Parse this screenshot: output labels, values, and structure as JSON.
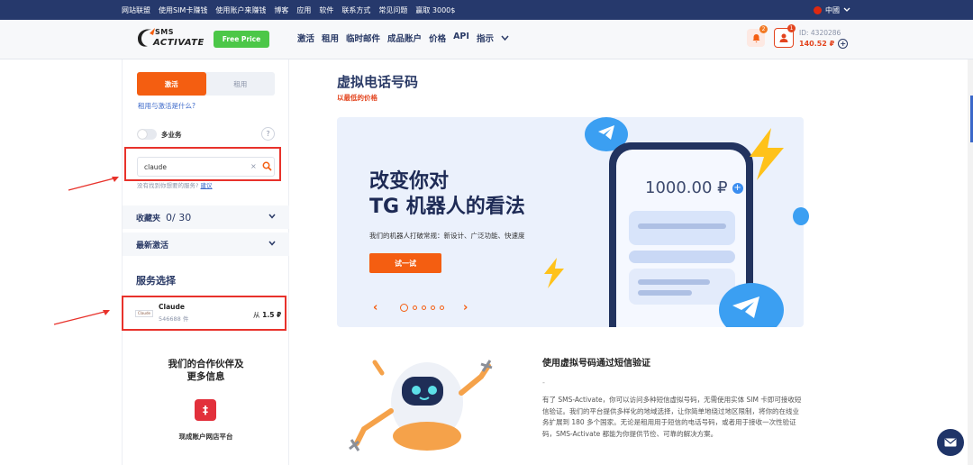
{
  "topbar": {
    "links": [
      "网站联盟",
      "使用SIM卡赚钱",
      "使用账户来赚钱",
      "博客",
      "应用",
      "软件",
      "联系方式",
      "常见问题",
      "赢取 3000$"
    ],
    "language": "中國"
  },
  "header": {
    "logo_line1": "SMS",
    "logo_line2": "ACTIVATE",
    "free_price": "Free Price",
    "nav": [
      "激活",
      "租用",
      "临时邮件",
      "成品账户",
      "价格",
      "API",
      "指示"
    ],
    "notifications_count": "2",
    "user_badge": "1",
    "account_id": "ID: 4320286",
    "balance": "140.52 ₽"
  },
  "sidebar": {
    "tab_activate": "激活",
    "tab_rent": "租用",
    "help_link": "租用与激活是什么?",
    "multi_service": "多业务",
    "help_symbol": "?",
    "search": {
      "value": "claude",
      "clear": "×"
    },
    "not_found": "没有找到你想要的服务?",
    "not_found_link": "建议",
    "favorites_label": "收藏夹",
    "favorites_count": "0/ 30",
    "recent_label": "最新激活",
    "services_title": "服务选择",
    "service": {
      "logo": "Claude",
      "name": "Claude",
      "count": "546688 件",
      "price_prefix": "从",
      "price": "1.5 ₽"
    },
    "partners_title_1": "我们的合作伙伴及",
    "partners_title_2": "更多信息",
    "partner_logo": "‡",
    "partner_name": "现成账户网店平台"
  },
  "main": {
    "title": "虚拟电话号码",
    "subtitle": "以最低的价格",
    "banner": {
      "title_1": "改变你对",
      "title_2": "TG 机器人的看法",
      "desc": "我们的机器人打破常规：新设计、广泛功能、快速度",
      "button": "试一试",
      "prev": "‹",
      "next": "›",
      "amount": "1000.00 ₽",
      "plus": "+"
    },
    "info_title": "使用虚拟号码通过短信验证",
    "info_dash": "-",
    "info_body": "有了 SMS-Activate，你可以访问多种短信虚拟号码，无需使用实体 SIM 卡即可接收短信验证。我们的平台提供多样化的地域选择，让你简单地绕过地区限制，将你的在线业务扩展到 180 多个国家。无论是租用用于短信的电话号码，或者用于接收一次性验证码，SMS-Activate 都能为你提供节俭、可靠的解决方案。"
  },
  "colors": {
    "accent": "#f45e11",
    "navy": "#26396c",
    "green": "#4cc748",
    "annotation_red": "#e8322b"
  }
}
